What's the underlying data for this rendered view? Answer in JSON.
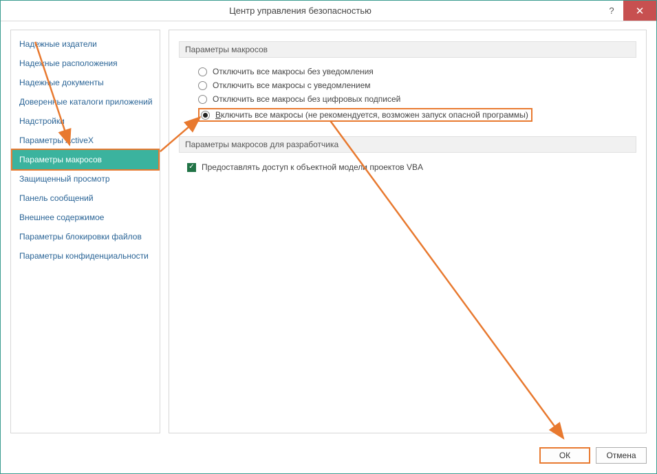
{
  "window": {
    "title": "Центр управления безопасностью"
  },
  "sidebar": {
    "items": [
      {
        "label": "Надежные издатели"
      },
      {
        "label": "Надежные расположения"
      },
      {
        "label": "Надежные документы"
      },
      {
        "label": "Доверенные каталоги приложений"
      },
      {
        "label": "Надстройки"
      },
      {
        "label": "Параметры ActiveX"
      },
      {
        "label": "Параметры макросов",
        "selected": true
      },
      {
        "label": "Защищенный просмотр"
      },
      {
        "label": "Панель сообщений"
      },
      {
        "label": "Внешнее содержимое"
      },
      {
        "label": "Параметры блокировки файлов"
      },
      {
        "label": "Параметры конфиденциальности"
      }
    ]
  },
  "content": {
    "section1_title": "Параметры макросов",
    "radios": [
      {
        "label": "Отключить все макросы без уведомления"
      },
      {
        "label": "Отключить все макросы с уведомлением"
      },
      {
        "label": "Отключить все макросы без цифровых подписей"
      },
      {
        "label_prefix": "В",
        "label_rest": "ключить все макросы (не рекомендуется, возможен запуск опасной программы)",
        "checked": true,
        "highlighted": true
      }
    ],
    "section2_title": "Параметры макросов для разработчика",
    "checkbox": {
      "label": "Предоставлять доступ к объектной модели проектов VBA",
      "checked": true
    }
  },
  "footer": {
    "ok": "ОК",
    "cancel": "Отмена"
  }
}
